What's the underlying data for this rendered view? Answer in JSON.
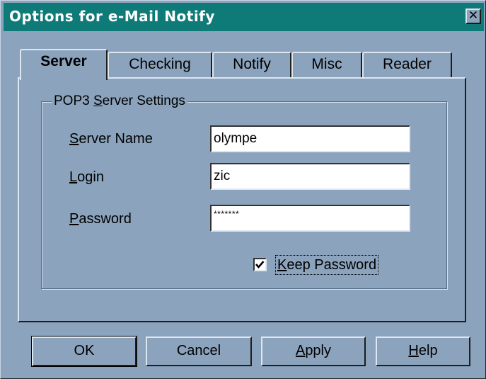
{
  "window": {
    "title": "Options for e-Mail Notify",
    "close_glyph": "✕"
  },
  "tabs": [
    {
      "label": "Server",
      "active": true
    },
    {
      "label": "Checking",
      "active": false
    },
    {
      "label": "Notify",
      "active": false
    },
    {
      "label": "Misc",
      "active": false
    },
    {
      "label": "Reader",
      "active": false
    }
  ],
  "group": {
    "legend_pre": "POP3 ",
    "legend_key": "S",
    "legend_post": "erver Settings"
  },
  "fields": {
    "server_name": {
      "label_key": "S",
      "label_rest": "erver Name",
      "value": "olympe"
    },
    "login": {
      "label_key": "L",
      "label_rest": "ogin",
      "value": "zic"
    },
    "password": {
      "label_key": "P",
      "label_rest": "assword",
      "value": "*******"
    }
  },
  "keep_password": {
    "label_key": "K",
    "label_rest": "eep Password",
    "checked": true
  },
  "buttons": {
    "ok": "OK",
    "cancel": "Cancel",
    "apply_key": "A",
    "apply_rest": "pply",
    "help_key": "H",
    "help_rest": "elp"
  },
  "colors": {
    "titlebar": "#0f7b78",
    "face": "#8ba3bd"
  }
}
